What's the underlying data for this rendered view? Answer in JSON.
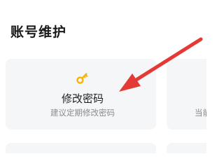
{
  "section": {
    "title": "账号维护"
  },
  "cards": {
    "password": {
      "icon": "key-icon",
      "title": "修改密码",
      "subtitle": "建议定期修改密码"
    },
    "partial": {
      "subtitle": "当前"
    }
  },
  "colors": {
    "icon_yellow": "#f5b400",
    "arrow_red": "#e53935",
    "card_bg": "#f5f6f8"
  }
}
